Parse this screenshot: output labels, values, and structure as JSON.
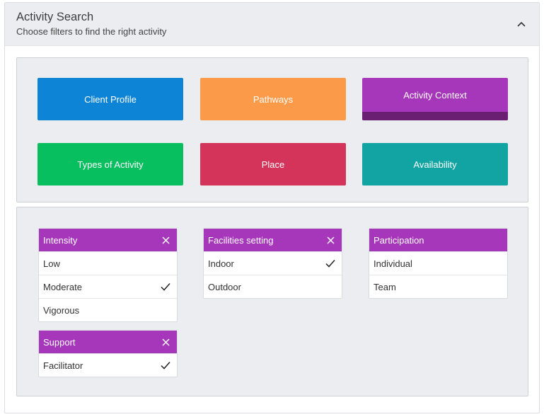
{
  "header": {
    "title": "Activity Search",
    "subtitle": "Choose filters to find the right activity"
  },
  "categories": [
    {
      "label": "Client Profile",
      "color": "#0d84d6",
      "active": false
    },
    {
      "label": "Pathways",
      "color": "#fb9a48",
      "active": false
    },
    {
      "label": "Activity Context",
      "color": "#a637ba",
      "active": true
    },
    {
      "label": "Types of Activity",
      "color": "#07bf5f",
      "active": false
    },
    {
      "label": "Place",
      "color": "#d4335a",
      "active": false
    },
    {
      "label": "Availability",
      "color": "#12a3a3",
      "active": false
    }
  ],
  "filters": [
    {
      "title": "Intensity",
      "closable": true,
      "options": [
        {
          "label": "Low",
          "checked": false
        },
        {
          "label": "Moderate",
          "checked": true
        },
        {
          "label": "Vigorous",
          "checked": false
        }
      ]
    },
    {
      "title": "Facilities setting",
      "closable": true,
      "options": [
        {
          "label": "Indoor",
          "checked": true
        },
        {
          "label": "Outdoor",
          "checked": false
        }
      ]
    },
    {
      "title": "Participation",
      "closable": false,
      "options": [
        {
          "label": "Individual",
          "checked": false
        },
        {
          "label": "Team",
          "checked": false
        }
      ]
    },
    {
      "title": "Support",
      "closable": true,
      "options": [
        {
          "label": "Facilitator",
          "checked": true
        }
      ]
    }
  ],
  "icons": {
    "collapse": "chevron-up-icon",
    "close": "close-icon",
    "check": "checkmark-icon"
  },
  "colors": {
    "filter_header": "#a637ba",
    "panel_bg": "#ebedf1",
    "active_indicator": "#6a1f72"
  }
}
